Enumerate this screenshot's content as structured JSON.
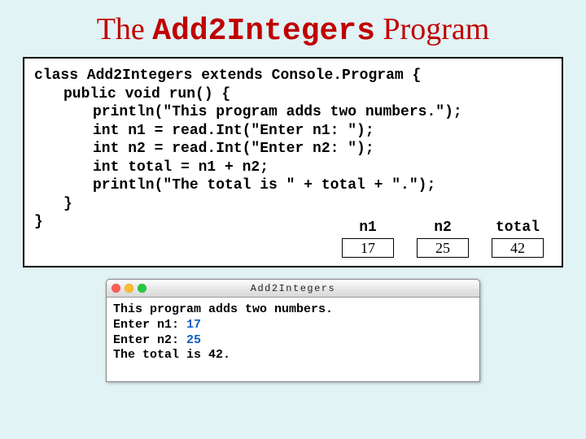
{
  "title": {
    "pre": "The ",
    "code": "Add2Integers",
    "post": " Program"
  },
  "code": {
    "l1a": "class Add2Integers extends Console.Program {",
    "l2": "public void run() {",
    "l3": "println(\"This program adds two numbers.\");",
    "l4": "int n1 = read.Int(\"Enter n1: \");",
    "l5": "int n2 = read.Int(\"Enter n2: \");",
    "l6": "int total = n1 + n2;",
    "l7": "println(\"The total is \" + total + \".\");",
    "l8": "}",
    "l9": "}"
  },
  "vars": {
    "n1": {
      "label": "n1",
      "value": "17"
    },
    "n2": {
      "label": "n2",
      "value": "25"
    },
    "total": {
      "label": "total",
      "value": "42"
    }
  },
  "console": {
    "title": "Add2Integers",
    "buttons": {
      "close": "#ff5f57",
      "min": "#ffbd2e",
      "max": "#28c840"
    },
    "lines": {
      "banner": "This program adds two numbers.",
      "p1_label": "Enter n1: ",
      "p1_val": "17",
      "p2_label": "Enter n2: ",
      "p2_val": "25",
      "result": "The total is 42."
    }
  }
}
